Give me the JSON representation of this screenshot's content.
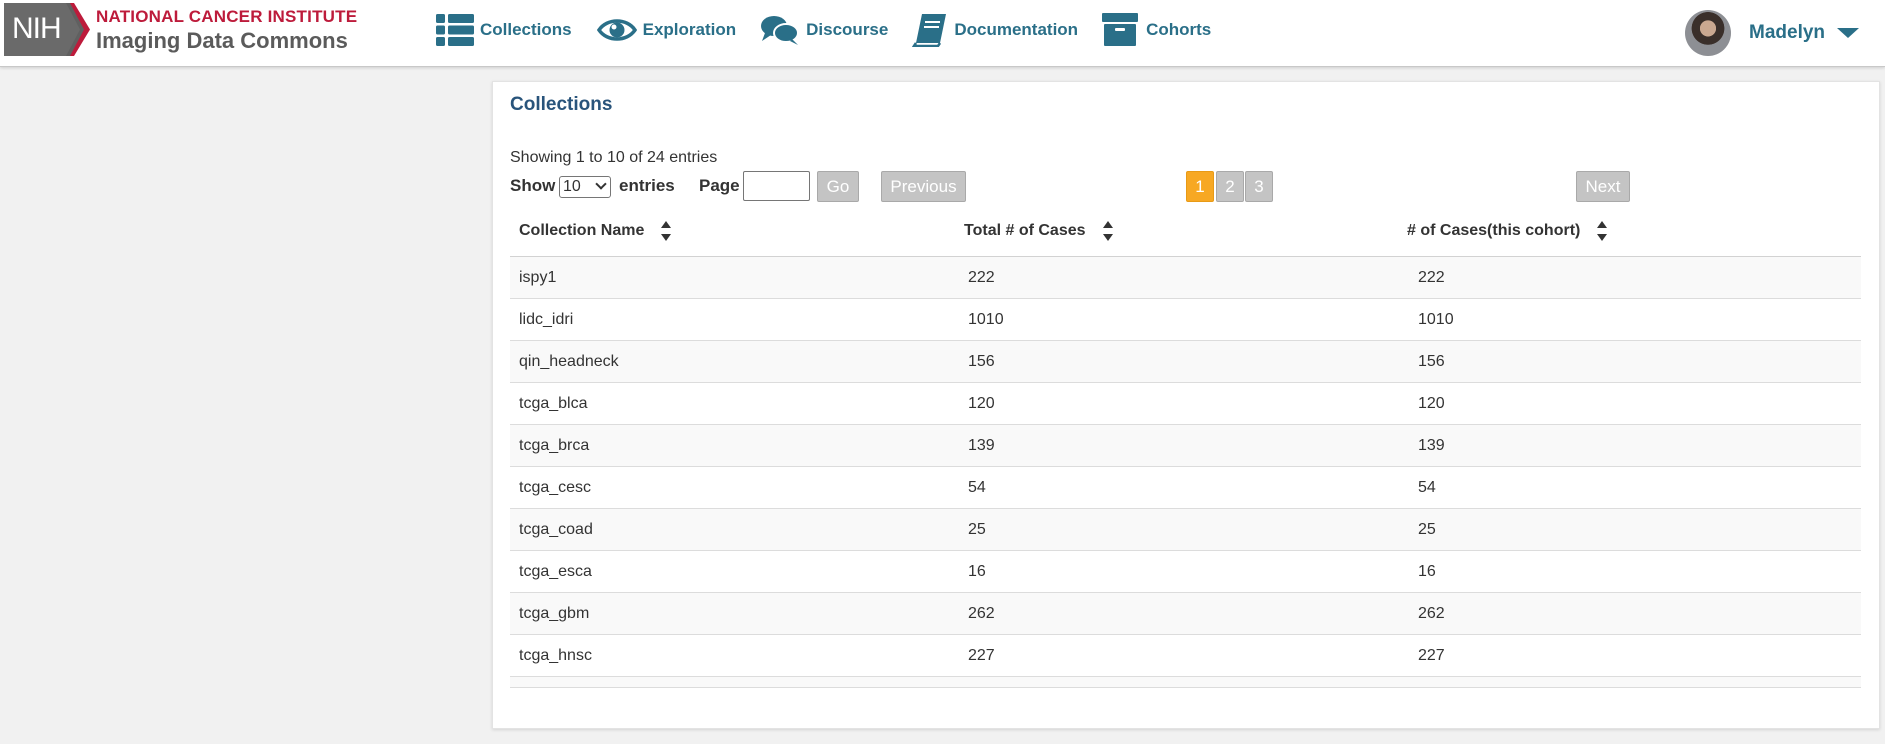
{
  "header": {
    "logo": {
      "nih": "NIH",
      "institute": "NATIONAL CANCER INSTITUTE",
      "product": "Imaging Data Commons"
    },
    "nav": [
      {
        "label": "Collections",
        "icon": "list-icon"
      },
      {
        "label": "Exploration",
        "icon": "eye-icon"
      },
      {
        "label": "Discourse",
        "icon": "chat-bubbles-icon"
      },
      {
        "label": "Documentation",
        "icon": "book-icon"
      },
      {
        "label": "Cohorts",
        "icon": "archive-box-icon"
      }
    ],
    "user": {
      "name": "Madelyn"
    }
  },
  "collections": {
    "title": "Collections",
    "showing_text": "Showing 1 to 10 of 24 entries",
    "show_label": "Show",
    "page_size": "10",
    "entries_label": "entries",
    "page_label": "Page",
    "page_input_value": "",
    "go_label": "Go",
    "previous_label": "Previous",
    "next_label": "Next",
    "pages": [
      "1",
      "2",
      "3"
    ],
    "current_page": "1",
    "columns": [
      "Collection Name",
      "Total # of Cases",
      "# of Cases(this cohort)"
    ],
    "rows": [
      [
        "ispy1",
        "222",
        "222"
      ],
      [
        "lidc_idri",
        "1010",
        "1010"
      ],
      [
        "qin_headneck",
        "156",
        "156"
      ],
      [
        "tcga_blca",
        "120",
        "120"
      ],
      [
        "tcga_brca",
        "139",
        "139"
      ],
      [
        "tcga_cesc",
        "54",
        "54"
      ],
      [
        "tcga_coad",
        "25",
        "25"
      ],
      [
        "tcga_esca",
        "16",
        "16"
      ],
      [
        "tcga_gbm",
        "262",
        "262"
      ],
      [
        "tcga_hnsc",
        "227",
        "227"
      ]
    ]
  },
  "colors": {
    "nih_red": "#bd1b3b",
    "nav_teal": "#2a6f88",
    "title_blue": "#29547b",
    "active_page": "#f7a823",
    "disabled_button": "#c4c4c4"
  }
}
